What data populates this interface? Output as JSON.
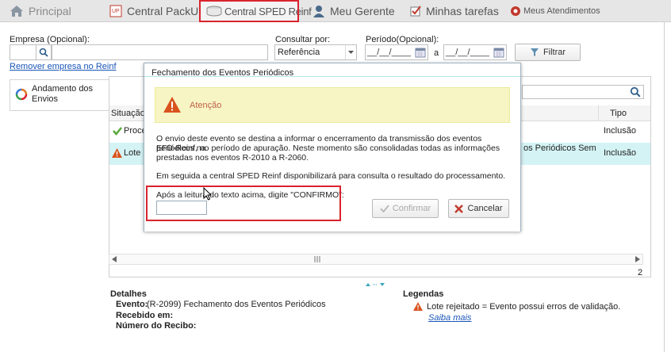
{
  "tabs": [
    {
      "label": "Principal",
      "icon": "home-icon"
    },
    {
      "label": "Central PackUp",
      "icon": "upload-icon"
    },
    {
      "label": "Central SPED Reinf",
      "icon": "database-icon"
    },
    {
      "label": "Meu Gerente",
      "icon": "user-icon"
    },
    {
      "label": "Minhas tarefas",
      "icon": "checkbox-icon"
    },
    {
      "label": "Meus Atendimentos",
      "icon": "support-icon"
    }
  ],
  "filters": {
    "empresa_label": "Empresa (Opcional):",
    "empresa_value": "",
    "consultar_label": "Consultar por:",
    "consultar_value": "Referência",
    "periodo_label": "Período(Opcional):",
    "periodo_from": "__/__/____",
    "periodo_sep": "a",
    "periodo_to": "__/__/____",
    "filtrar_label": "Filtrar",
    "remover_link": "Remover empresa no Reinf"
  },
  "nav": {
    "andamento_line1": "Andamento dos",
    "andamento_line2": "Envios"
  },
  "table": {
    "headers": {
      "situacao": "Situação",
      "tipo": "Tipo"
    },
    "rows": [
      {
        "situacao": "Proce",
        "desc": "",
        "tipo": "Inclusão",
        "status_icon": "check-icon"
      },
      {
        "situacao": "Lote r",
        "desc": "os Periódicos Sem",
        "tipo": "Inclusão",
        "status_icon": "warning-icon"
      }
    ],
    "count": "2"
  },
  "details": {
    "title": "Detalhes",
    "evento_label": "Evento:",
    "evento_value": "(R-2099) Fechamento dos Eventos Periódicos",
    "recebido_label": "Recebido em:",
    "recebido_value": "",
    "recibo_label": "Número do Recibo:",
    "recibo_value": ""
  },
  "legend": {
    "title": "Legendas",
    "item": "Lote rejeitado = Evento possui erros de validação.",
    "saiba_mais": "Saiba mais"
  },
  "modal": {
    "title": "Fechamento dos Eventos Periódicos",
    "warning_title": "Atenção",
    "para1_line1": "O envio deste evento se destina a informar o encerramento da transmissão dos eventos periódicos na",
    "para1_line2": "EFD-Reinf, no período de apuração. Neste momento são consolidadas todas as informações",
    "para1_line3": "prestadas nos eventos R-2010 a R-2060.",
    "para2": "Em seguida a central SPED Reinf disponibilizará para consulta o resultado do processamento.",
    "input_label": "Após a leitura do texto acima, digite \"CONFIRMO\":",
    "input_value": "",
    "confirm_label": "Confirmar",
    "cancel_label": "Cancelar"
  },
  "colors": {
    "highlight": "#d9232e",
    "link": "#1a55b8",
    "warning_bg": "#f7f5c4",
    "selected_row": "#d4f3f5"
  }
}
